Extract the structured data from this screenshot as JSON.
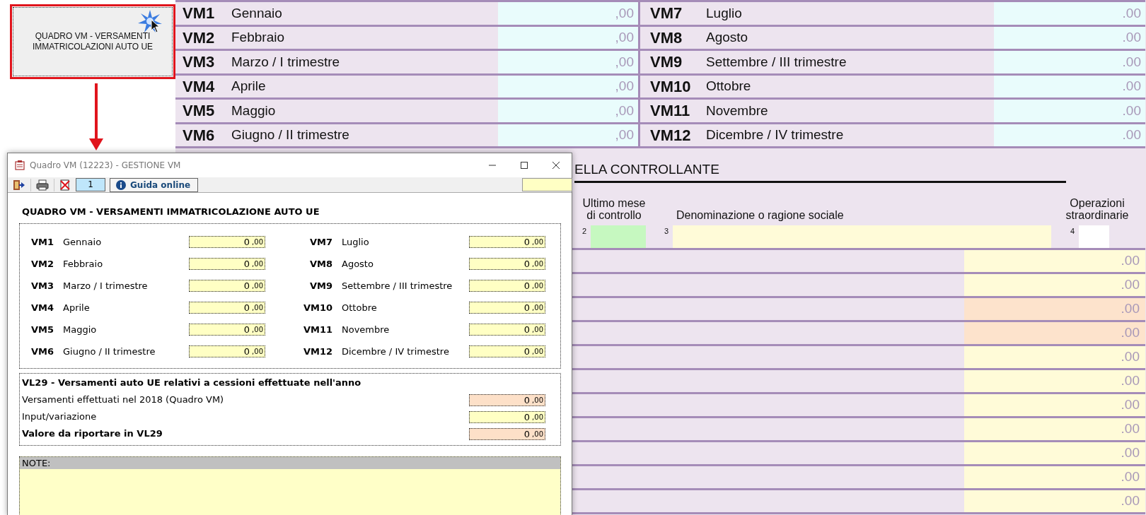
{
  "launch_button": {
    "label": "QUADRO VM - VERSAMENTI IMMATRICOLAZIONI AUTO UE"
  },
  "form": {
    "months": [
      {
        "code": "VM1",
        "name": "Gennaio",
        "value": ",00"
      },
      {
        "code": "VM2",
        "name": "Febbraio",
        "value": ",00"
      },
      {
        "code": "VM3",
        "name": "Marzo / I trimestre",
        "value": ",00"
      },
      {
        "code": "VM4",
        "name": "Aprile",
        "value": ",00"
      },
      {
        "code": "VM5",
        "name": "Maggio",
        "value": ",00"
      },
      {
        "code": "VM6",
        "name": "Giugno / II trimestre",
        "value": ",00"
      },
      {
        "code": "VM7",
        "name": "Luglio",
        "value": ".00"
      },
      {
        "code": "VM8",
        "name": "Agosto",
        "value": ".00"
      },
      {
        "code": "VM9",
        "name": "Settembre / III trimestre",
        "value": ".00"
      },
      {
        "code": "VM10",
        "name": "Ottobre",
        "value": ".00"
      },
      {
        "code": "VM11",
        "name": "Novembre",
        "value": ".00"
      },
      {
        "code": "VM12",
        "name": "Dicembre / IV trimestre",
        "value": ".00"
      }
    ],
    "controllante": {
      "heading": "ELLA CONTROLLANTE",
      "columns": [
        {
          "number": "2",
          "label": "Ultimo mese di controllo",
          "kind": "month"
        },
        {
          "number": "3",
          "label": "Denominazione o ragione sociale",
          "kind": "name"
        },
        {
          "number": "4",
          "label": "Operazioni straordinarie",
          "kind": "flag"
        }
      ],
      "rows": [
        {
          "kind": "input",
          "value": ".00"
        },
        {
          "kind": "input",
          "value": ".00"
        },
        {
          "kind": "calculated",
          "value": ".00"
        },
        {
          "kind": "calculated",
          "value": ".00"
        },
        {
          "kind": "input",
          "value": ".00"
        },
        {
          "kind": "input",
          "value": ".00"
        },
        {
          "kind": "input",
          "value": ".00"
        },
        {
          "kind": "input",
          "value": ".00"
        },
        {
          "kind": "input",
          "value": ".00"
        },
        {
          "kind": "input",
          "value": ".00"
        },
        {
          "kind": "input",
          "value": ".00"
        }
      ]
    }
  },
  "dialog": {
    "title": "Quadro VM (12223) - GESTIONE VM",
    "page": "1",
    "help_button": "Guida online",
    "section_title": "QUADRO VM - VERSAMENTI IMMATRICOLAZIONE AUTO UE",
    "months": [
      {
        "code": "VM1",
        "name": "Gennaio",
        "value": "0",
        "decimals": ",00"
      },
      {
        "code": "VM2",
        "name": "Febbraio",
        "value": "0",
        "decimals": ",00"
      },
      {
        "code": "VM3",
        "name": "Marzo / I trimestre",
        "value": "0",
        "decimals": ",00"
      },
      {
        "code": "VM4",
        "name": "Aprile",
        "value": "0",
        "decimals": ",00"
      },
      {
        "code": "VM5",
        "name": "Maggio",
        "value": "0",
        "decimals": ",00"
      },
      {
        "code": "VM6",
        "name": "Giugno / II trimestre",
        "value": "0",
        "decimals": ",00"
      },
      {
        "code": "VM7",
        "name": "Luglio",
        "value": "0",
        "decimals": ",00"
      },
      {
        "code": "VM8",
        "name": "Agosto",
        "value": "0",
        "decimals": ",00"
      },
      {
        "code": "VM9",
        "name": "Settembre / III trimestre",
        "value": "0",
        "decimals": ",00"
      },
      {
        "code": "VM10",
        "name": "Ottobre",
        "value": "0",
        "decimals": ",00"
      },
      {
        "code": "VM11",
        "name": "Novembre",
        "value": "0",
        "decimals": ",00"
      },
      {
        "code": "VM12",
        "name": "Dicembre / IV trimestre",
        "value": "0",
        "decimals": ",00"
      }
    ],
    "vl29": {
      "title": "VL29 - Versamenti auto UE relativi a cessioni effettuate nell'anno",
      "rows": [
        {
          "label": "Versamenti effettuati nel 2018 (Quadro VM)",
          "value": "0",
          "decimals": ",00",
          "kind": "calculated",
          "bold": false
        },
        {
          "label": "Input/variazione",
          "value": "0",
          "decimals": ",00",
          "kind": "input",
          "bold": false
        },
        {
          "label": "Valore da riportare in VL29",
          "value": "0",
          "decimals": ",00",
          "kind": "calculated",
          "bold": true
        }
      ]
    },
    "note": {
      "label": "NOTE:"
    }
  }
}
